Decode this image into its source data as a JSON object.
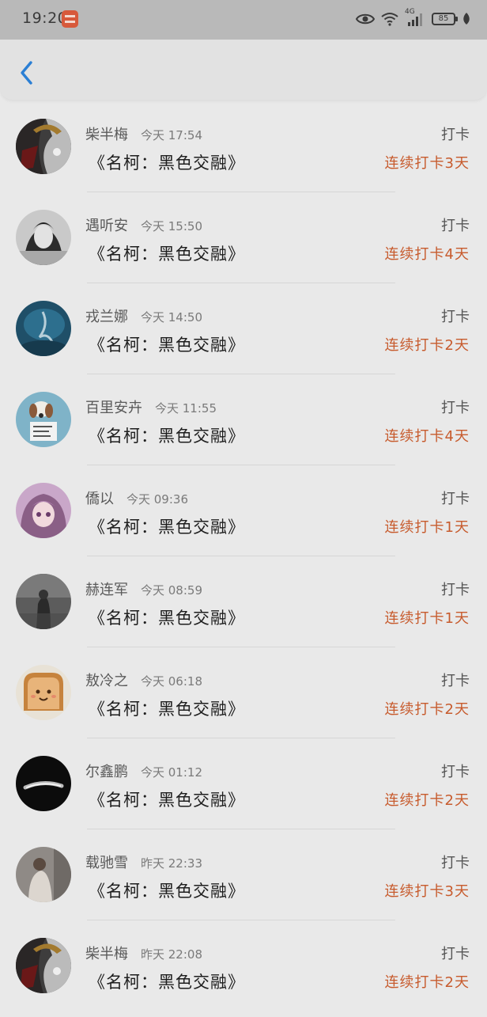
{
  "status_bar": {
    "time": "19:20",
    "network": "4G",
    "battery": "85",
    "icons": [
      "eye-icon",
      "wifi-icon",
      "signal-icon",
      "battery-icon",
      "leaf-icon"
    ]
  },
  "header": {
    "back_icon": "chevron-left-icon",
    "accent_color": "#2b7fd4"
  },
  "colors": {
    "streak": "#c75b2d",
    "background": "#e9e9e9"
  },
  "items": [
    {
      "name": "柴半梅",
      "time": "今天 17:54",
      "book": "《名柯：黑色交融》",
      "action": "打卡",
      "streak": "连续打卡3天"
    },
    {
      "name": "遇听安",
      "time": "今天 15:50",
      "book": "《名柯：黑色交融》",
      "action": "打卡",
      "streak": "连续打卡4天"
    },
    {
      "name": "戎兰娜",
      "time": "今天 14:50",
      "book": "《名柯：黑色交融》",
      "action": "打卡",
      "streak": "连续打卡2天"
    },
    {
      "name": "百里安卉",
      "time": "今天 11:55",
      "book": "《名柯：黑色交融》",
      "action": "打卡",
      "streak": "连续打卡4天"
    },
    {
      "name": "僑以",
      "time": "今天 09:36",
      "book": "《名柯：黑色交融》",
      "action": "打卡",
      "streak": "连续打卡1天"
    },
    {
      "name": "赫连军",
      "time": "今天 08:59",
      "book": "《名柯：黑色交融》",
      "action": "打卡",
      "streak": "连续打卡1天"
    },
    {
      "name": "敖冷之",
      "time": "今天 06:18",
      "book": "《名柯：黑色交融》",
      "action": "打卡",
      "streak": "连续打卡2天"
    },
    {
      "name": "尔鑫鹏",
      "time": "今天 01:12",
      "book": "《名柯：黑色交融》",
      "action": "打卡",
      "streak": "连续打卡2天"
    },
    {
      "name": "载驰雪",
      "time": "昨天 22:33",
      "book": "《名柯：黑色交融》",
      "action": "打卡",
      "streak": "连续打卡3天"
    },
    {
      "name": "柴半梅",
      "time": "昨天 22:08",
      "book": "《名柯：黑色交融》",
      "action": "打卡",
      "streak": "连续打卡2天"
    }
  ]
}
